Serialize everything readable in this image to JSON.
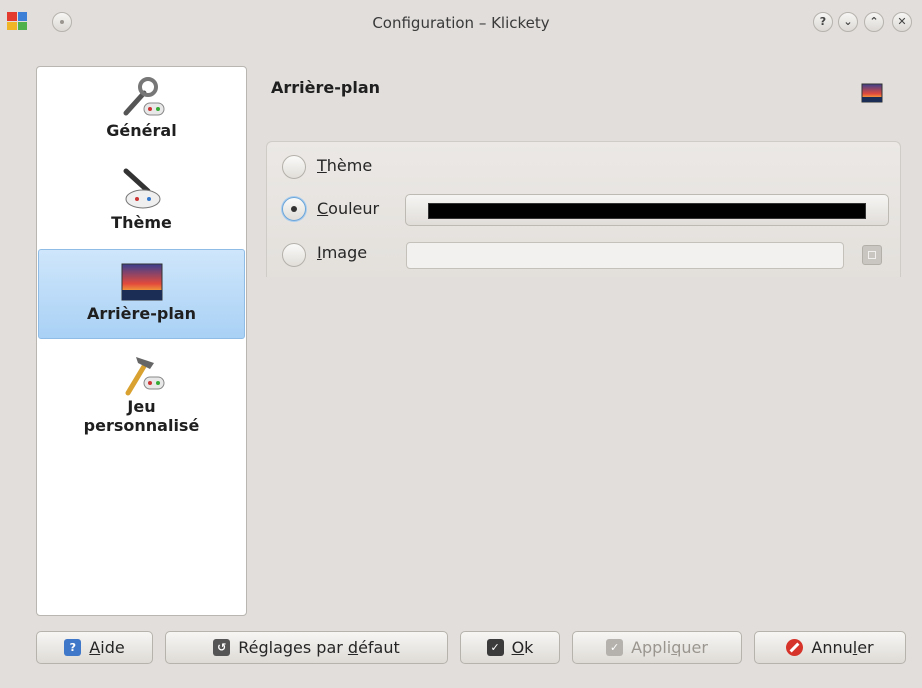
{
  "window": {
    "title": "Configuration – Klickety"
  },
  "titlebar": {
    "buttons": [
      {
        "name": "help-icon",
        "glyph": "?"
      },
      {
        "name": "minimize-icon",
        "glyph": "⌄"
      },
      {
        "name": "maximize-icon",
        "glyph": "⌃"
      },
      {
        "name": "close-icon",
        "glyph": "✕"
      }
    ]
  },
  "sidebar": {
    "items": [
      {
        "label": "Général",
        "icon": "tools-gamepad-icon"
      },
      {
        "label": "Thème",
        "icon": "brush-gamepad-icon"
      },
      {
        "label": "Arrière-plan",
        "icon": "landscape-image-icon",
        "selected": true
      },
      {
        "label_line1": "Jeu",
        "label_line2": "personnalisé",
        "icon": "hammer-gamepad-icon"
      }
    ]
  },
  "page": {
    "title": "Arrière-plan",
    "options": [
      {
        "key": "T",
        "rest": "hème",
        "checked": false
      },
      {
        "key": "C",
        "rest": "ouleur",
        "checked": true
      },
      {
        "key": "I",
        "rest": "mage",
        "checked": false
      }
    ],
    "color_value": "#000000",
    "image_value": ""
  },
  "buttons": {
    "help": {
      "pre": "",
      "key": "A",
      "post": "ide"
    },
    "defaults": {
      "pre": "Réglages par ",
      "key": "d",
      "post": "éfaut"
    },
    "ok": {
      "pre": "",
      "key": "O",
      "post": "k"
    },
    "apply": {
      "pre": "Appli",
      "key": "q",
      "post": "uer",
      "disabled": true
    },
    "cancel": {
      "pre": "Annu",
      "key": "l",
      "post": "er"
    }
  },
  "colors": {
    "selection": "#a9d1f5",
    "accent": "#3f78c8",
    "cancel": "#d6342a"
  }
}
